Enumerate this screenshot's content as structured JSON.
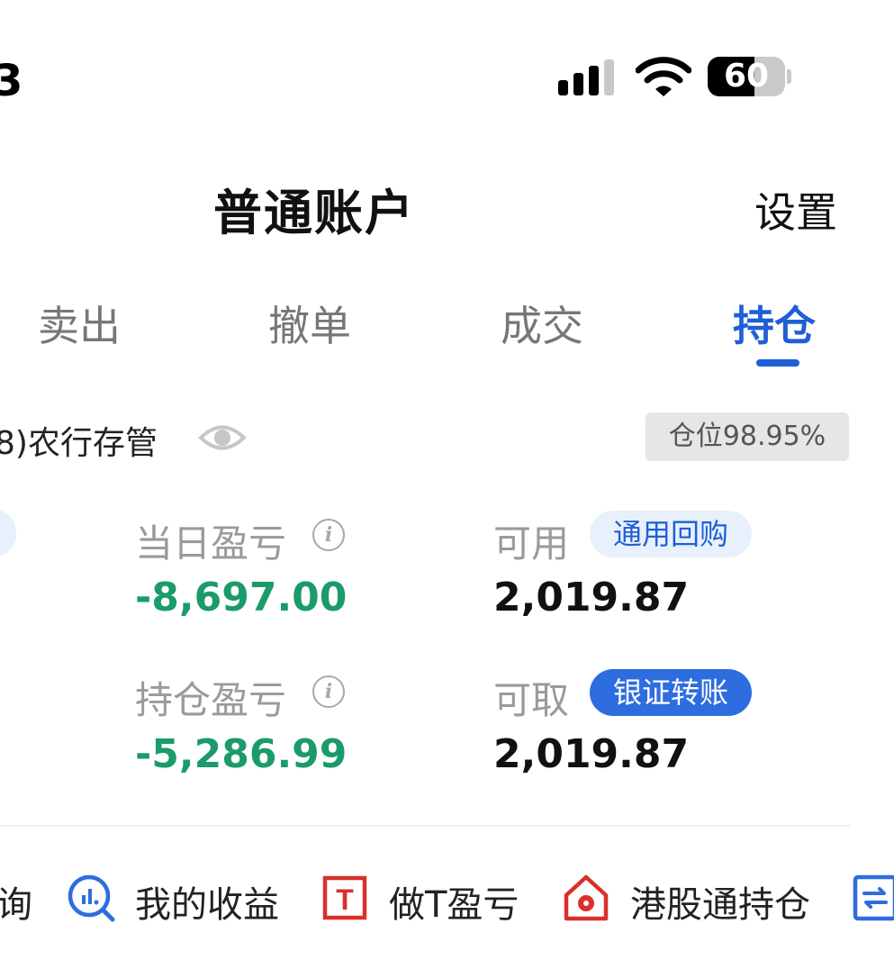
{
  "status_bar": {
    "time": "3",
    "battery": "60"
  },
  "header": {
    "title": "普通账户",
    "settings": "设置"
  },
  "tabs": [
    {
      "label": "卖出"
    },
    {
      "label": "撤单"
    },
    {
      "label": "成交"
    },
    {
      "label": "持仓",
      "active": true
    }
  ],
  "account": {
    "label": "8)农行存管",
    "position_ratio": "仓位98.95%"
  },
  "metrics": {
    "daily_pl": {
      "label": "当日盈亏",
      "value": "-8,697.00"
    },
    "available": {
      "label": "可用",
      "value": "2,019.87",
      "badge": "通用回购"
    },
    "holding_pl": {
      "label": "持仓盈亏",
      "value": "-5,286.99"
    },
    "withdrawable": {
      "label": "可取",
      "value": "2,019.87",
      "badge": "银证转账"
    }
  },
  "shortcuts": [
    {
      "label": "询"
    },
    {
      "label": "我的收益",
      "icon": "chart-search-icon"
    },
    {
      "label": "做T盈亏",
      "icon": "t-box-icon"
    },
    {
      "label": "港股通持仓",
      "icon": "hk-house-icon"
    },
    {
      "label": "",
      "icon": "transfer-icon"
    }
  ],
  "colors": {
    "accent": "#1f5fd6",
    "negative": "#1b9b6a",
    "label_gray": "#9a9a9a",
    "red_icon": "#d9302c"
  }
}
